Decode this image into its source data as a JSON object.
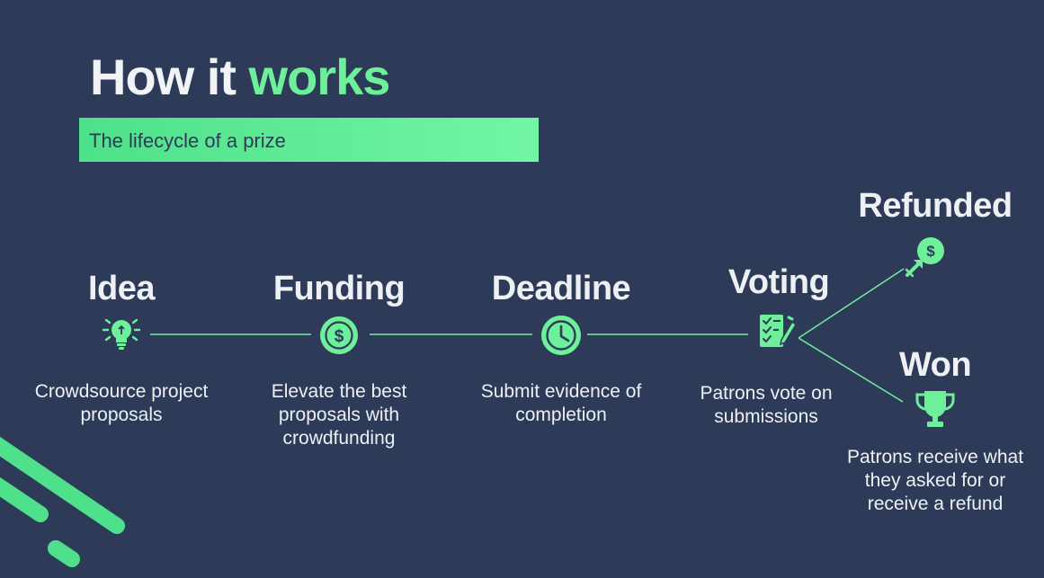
{
  "heading": {
    "part1": "How it ",
    "part2": "works"
  },
  "subtitle": "The lifecycle of a prize",
  "stages": {
    "idea": {
      "label": "Idea",
      "icon": "lightbulb-icon",
      "description": "Crowdsource project proposals"
    },
    "funding": {
      "label": "Funding",
      "icon": "dollar-coin-icon",
      "description": "Elevate the best proposals with crowdfunding"
    },
    "deadline": {
      "label": "Deadline",
      "icon": "clock-icon",
      "description": "Submit evidence of completion"
    },
    "voting": {
      "label": "Voting",
      "icon": "ballot-checklist-icon",
      "description": "Patrons vote on submissions"
    },
    "refunded": {
      "label": "Refunded",
      "icon": "refund-coin-icon",
      "description": ""
    },
    "won": {
      "label": "Won",
      "icon": "trophy-icon",
      "description": "Patrons receive what they asked for or receive a refund"
    }
  },
  "colors": {
    "background": "#2d3b59",
    "accent": "#6ef09a",
    "text": "#eef0f4"
  }
}
